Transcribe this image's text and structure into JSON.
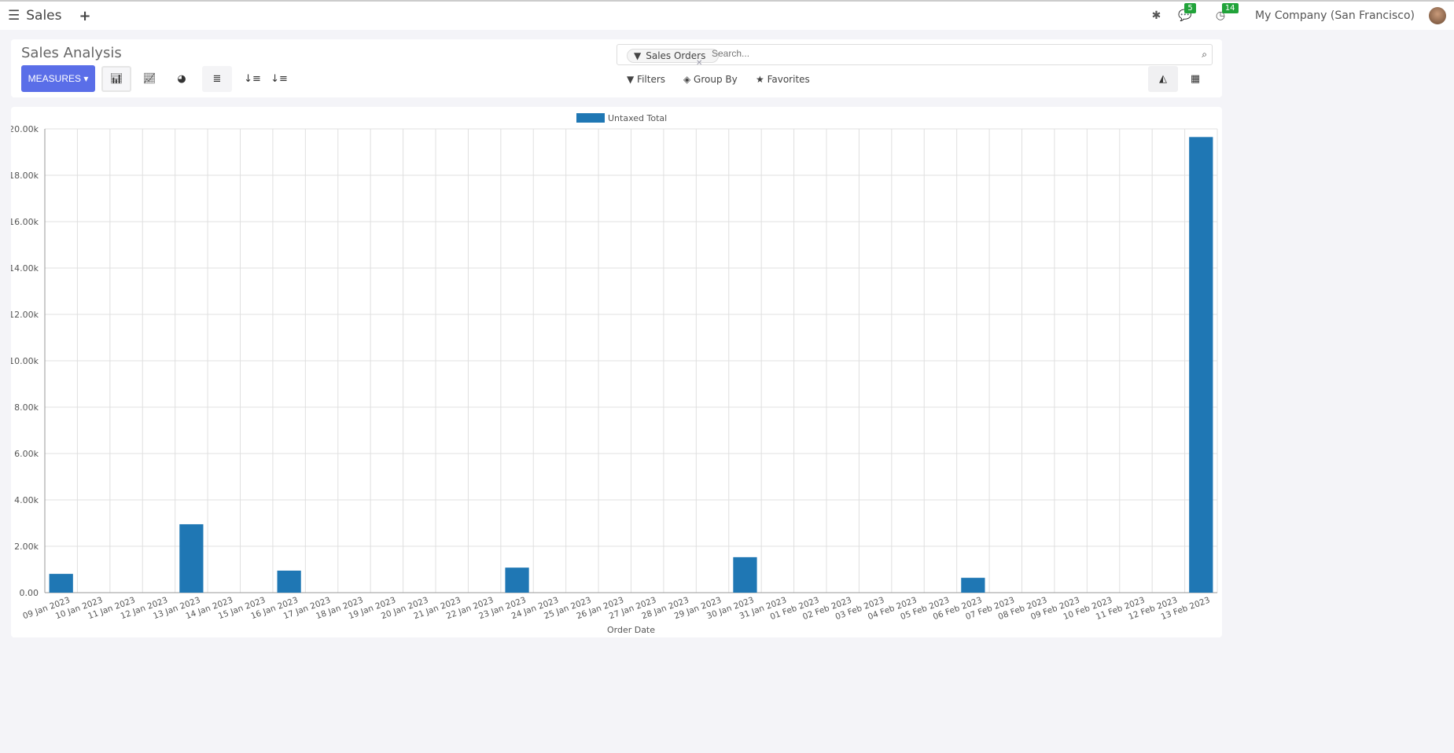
{
  "nav": {
    "app": "Sales",
    "company": "My Company (San Francisco)",
    "messages_count": "5",
    "activities_count": "14",
    "icons": [
      "menu-icon",
      "plus-icon",
      "bug-icon",
      "chat-icon",
      "clock-icon"
    ]
  },
  "control": {
    "title": "Sales Analysis",
    "measures": "MEASURES",
    "search_facet": "Sales Orders",
    "search_placeholder": "Search...",
    "filters": "Filters",
    "group_by": "Group By",
    "favorites": "Favorites"
  },
  "colors": {
    "accent": "#5a6ee8",
    "bar": "#1f77b4",
    "badge": "#21a33a"
  },
  "chart_data": {
    "type": "bar",
    "legend": [
      "Untaxed Total"
    ],
    "legend_position": "top",
    "xlabel": "Order Date",
    "ylabel": "",
    "ylim": [
      0,
      20000
    ],
    "yticks": [
      "0.00",
      "2.00k",
      "4.00k",
      "6.00k",
      "8.00k",
      "10.00k",
      "12.00k",
      "14.00k",
      "16.00k",
      "18.00k",
      "20.00k"
    ],
    "grid": true,
    "categories": [
      "09 Jan 2023",
      "10 Jan 2023",
      "11 Jan 2023",
      "12 Jan 2023",
      "13 Jan 2023",
      "14 Jan 2023",
      "15 Jan 2023",
      "16 Jan 2023",
      "17 Jan 2023",
      "18 Jan 2023",
      "19 Jan 2023",
      "20 Jan 2023",
      "21 Jan 2023",
      "22 Jan 2023",
      "23 Jan 2023",
      "24 Jan 2023",
      "25 Jan 2023",
      "26 Jan 2023",
      "27 Jan 2023",
      "28 Jan 2023",
      "29 Jan 2023",
      "30 Jan 2023",
      "31 Jan 2023",
      "01 Feb 2023",
      "02 Feb 2023",
      "03 Feb 2023",
      "04 Feb 2023",
      "05 Feb 2023",
      "06 Feb 2023",
      "07 Feb 2023",
      "08 Feb 2023",
      "09 Feb 2023",
      "10 Feb 2023",
      "11 Feb 2023",
      "12 Feb 2023",
      "13 Feb 2023"
    ],
    "series": [
      {
        "name": "Untaxed Total",
        "values": [
          810,
          0,
          0,
          0,
          2950,
          0,
          0,
          950,
          0,
          0,
          0,
          0,
          0,
          0,
          1080,
          0,
          0,
          0,
          0,
          0,
          0,
          1530,
          0,
          0,
          0,
          0,
          0,
          0,
          640,
          0,
          0,
          0,
          0,
          0,
          0,
          19650
        ]
      }
    ]
  }
}
